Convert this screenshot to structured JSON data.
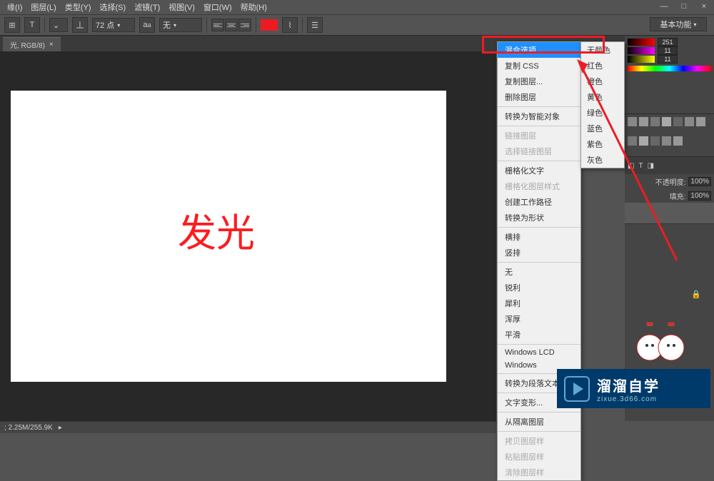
{
  "menu": {
    "items": [
      "缘(I)",
      "图层(L)",
      "类型(Y)",
      "选择(S)",
      "滤镜(T)",
      "视图(V)",
      "窗口(W)",
      "帮助(H)"
    ]
  },
  "options": {
    "font_size": "72 点",
    "aa": "无",
    "text_color": "#ec1b23"
  },
  "workspace_label": "基本功能",
  "tab": {
    "label": "光, RGB/8)",
    "close": "×"
  },
  "canvas_text": "发光",
  "status": {
    "zoom": "2.25M/255.9K"
  },
  "context_menu": {
    "items": [
      {
        "label": "混合选项...",
        "hl": true
      },
      {
        "label": "复制 CSS"
      },
      {
        "label": "复制图层..."
      },
      {
        "label": "删除图层"
      },
      {
        "sep": true
      },
      {
        "label": "转换为智能对象"
      },
      {
        "sep": true
      },
      {
        "label": "链接图层",
        "disabled": true
      },
      {
        "label": "选择链接图层",
        "disabled": true
      },
      {
        "sep": true
      },
      {
        "label": "栅格化文字"
      },
      {
        "label": "栅格化图层样式",
        "disabled": true
      },
      {
        "label": "创建工作路径"
      },
      {
        "label": "转换为形状"
      },
      {
        "sep": true
      },
      {
        "label": "横排"
      },
      {
        "label": "竖排"
      },
      {
        "sep": true
      },
      {
        "label": "无"
      },
      {
        "label": "锐利"
      },
      {
        "label": "犀利"
      },
      {
        "label": "浑厚"
      },
      {
        "label": "平滑"
      },
      {
        "sep": true
      },
      {
        "label": "Windows LCD"
      },
      {
        "label": "Windows"
      },
      {
        "sep": true
      },
      {
        "label": "转换为段落文本"
      },
      {
        "sep": true
      },
      {
        "label": "文字变形..."
      },
      {
        "sep": true
      },
      {
        "label": "从隔离图层"
      },
      {
        "sep": true
      },
      {
        "label": "拷贝图层样",
        "disabled": true
      },
      {
        "label": "粘贴图层样",
        "disabled": true
      },
      {
        "label": "清除图层样",
        "disabled": true
      }
    ]
  },
  "submenu": {
    "items": [
      "无颜色",
      "红色",
      "橙色",
      "黄色",
      "绿色",
      "蓝色",
      "紫色",
      "灰色"
    ]
  },
  "color_values": {
    "r": "251",
    "g": "11",
    "b": "11"
  },
  "layers": {
    "opacity_label": "不透明度:",
    "opacity_val": "100%",
    "fill_label": "填充:",
    "fill_val": "100%"
  },
  "watermark": {
    "main": "溜溜自学",
    "sub": "zixue.3d66.com"
  }
}
